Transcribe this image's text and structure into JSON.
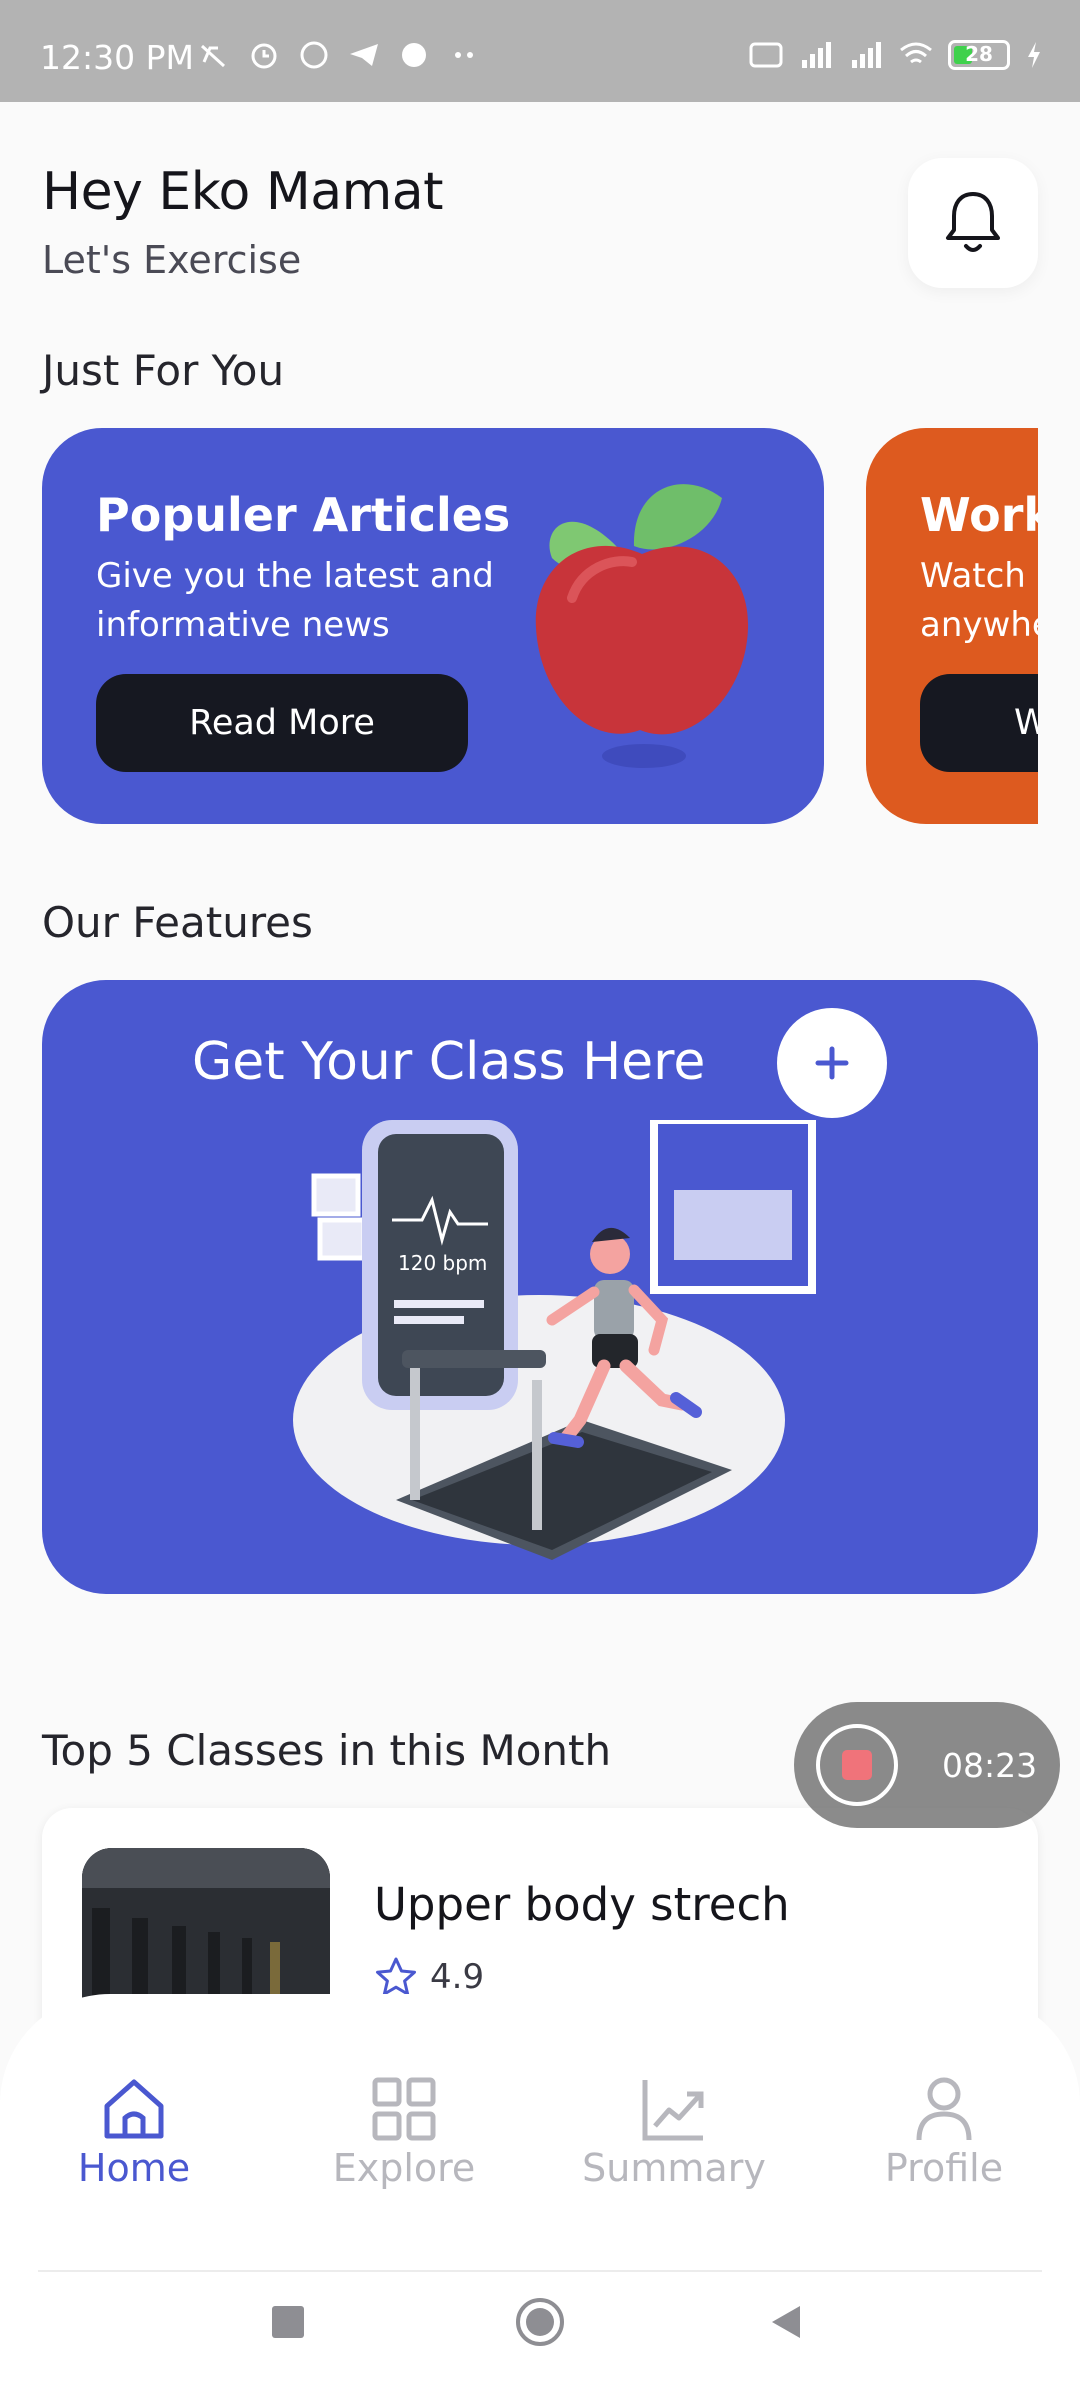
{
  "status_bar": {
    "time": "12:30 PM",
    "left_icons": [
      "mute-icon",
      "alarm-icon",
      "whatsapp-icon",
      "telegram-icon",
      "app-icon",
      "more-dots-icon"
    ],
    "right_icons": [
      "volte-icon",
      "signal-4g-icon",
      "signal-icon",
      "wifi-icon",
      "battery-icon",
      "charging-icon"
    ],
    "battery": "28"
  },
  "header": {
    "greeting": "Hey Eko Mamat",
    "subtitle": "Let's Exercise"
  },
  "sections": {
    "just_for_you": "Just For You",
    "our_features": "Our Features",
    "top_classes": "Top 5 Classes in this Month"
  },
  "cards": [
    {
      "title": "Populer Articles",
      "description": "Give you the latest and informative news",
      "button": "Read More",
      "color": "#4a58d0"
    },
    {
      "title": "Work",
      "description_line1": "Watch a",
      "description_line2": "anywhe",
      "button": "Wo",
      "color": "#dd5a1f"
    }
  ],
  "feature": {
    "title": "Get Your Class Here",
    "illustration_label": "120 bpm"
  },
  "top_class": {
    "name": "Upper body strech",
    "rating": "4.9"
  },
  "recording": {
    "time": "08:23"
  },
  "bottom_nav": {
    "items": [
      {
        "label": "Home",
        "icon": "home-icon",
        "active": true
      },
      {
        "label": "Explore",
        "icon": "grid-icon",
        "active": false
      },
      {
        "label": "Summary",
        "icon": "chart-icon",
        "active": false
      },
      {
        "label": "Profile",
        "icon": "user-icon",
        "active": false
      }
    ]
  },
  "colors": {
    "primary": "#4a58d0",
    "accent": "#dd5a1f",
    "dark_button": "#161821",
    "background": "#fafafa"
  }
}
